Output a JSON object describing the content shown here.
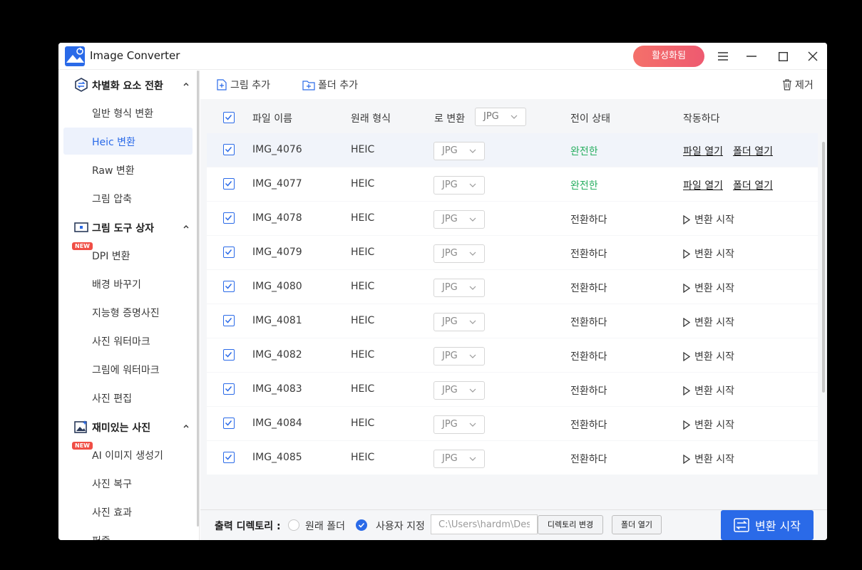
{
  "app": {
    "title": "Image Converter",
    "activate_label": "활성화됨"
  },
  "colors": {
    "accent": "#2a6ae8",
    "done": "#27ae60",
    "activate_start": "#f4706a",
    "activate_end": "#ee5a70",
    "badge": "#f04e45"
  },
  "sidebar": {
    "new_badge": "NEW",
    "groups": [
      {
        "label": "차별화 요소 전환",
        "icon": "convert-icon",
        "items": [
          {
            "label": "일반 형식 변환",
            "active": false,
            "new": false
          },
          {
            "label": "Heic 변환",
            "active": true,
            "new": false
          },
          {
            "label": "Raw 변환",
            "active": false,
            "new": false
          },
          {
            "label": "그림 압축",
            "active": false,
            "new": false
          }
        ]
      },
      {
        "label": "그림 도구 상자",
        "icon": "toolbox-icon",
        "items": [
          {
            "label": "DPI 변환",
            "active": false,
            "new": true
          },
          {
            "label": "배경 바꾸기",
            "active": false,
            "new": false
          },
          {
            "label": "지능형 증명사진",
            "active": false,
            "new": false
          },
          {
            "label": "사진 워터마크",
            "active": false,
            "new": false
          },
          {
            "label": "그림에 워터마크",
            "active": false,
            "new": false
          },
          {
            "label": "사진 편집",
            "active": false,
            "new": false
          }
        ]
      },
      {
        "label": "재미있는 사진",
        "icon": "fun-photo-icon",
        "items": [
          {
            "label": "AI 이미지 생성기",
            "active": false,
            "new": true
          },
          {
            "label": "사진 복구",
            "active": false,
            "new": false
          },
          {
            "label": "사진 효과",
            "active": false,
            "new": false
          },
          {
            "label": "퍼즐",
            "active": false,
            "new": false
          }
        ]
      }
    ]
  },
  "toolbar": {
    "add_image": "그림 추가",
    "add_folder": "폴더 추가",
    "remove": "제거"
  },
  "table": {
    "headers": {
      "name": "파일 이름",
      "orig": "원래 형식",
      "convert_to": "로 변환",
      "status": "전이 상태",
      "action": "작동하다"
    },
    "head_format": "JPG",
    "open_file": "파일 열기",
    "open_folder": "폴더 열기",
    "start_label": "변환 시작",
    "rows": [
      {
        "name": "IMG_4076",
        "orig": "HEIC",
        "format": "JPG",
        "status": "완전한",
        "done": true
      },
      {
        "name": "IMG_4077",
        "orig": "HEIC",
        "format": "JPG",
        "status": "완전한",
        "done": true
      },
      {
        "name": "IMG_4078",
        "orig": "HEIC",
        "format": "JPG",
        "status": "전환하다",
        "done": false
      },
      {
        "name": "IMG_4079",
        "orig": "HEIC",
        "format": "JPG",
        "status": "전환하다",
        "done": false
      },
      {
        "name": "IMG_4080",
        "orig": "HEIC",
        "format": "JPG",
        "status": "전환하다",
        "done": false
      },
      {
        "name": "IMG_4081",
        "orig": "HEIC",
        "format": "JPG",
        "status": "전환하다",
        "done": false
      },
      {
        "name": "IMG_4082",
        "orig": "HEIC",
        "format": "JPG",
        "status": "전환하다",
        "done": false
      },
      {
        "name": "IMG_4083",
        "orig": "HEIC",
        "format": "JPG",
        "status": "전환하다",
        "done": false
      },
      {
        "name": "IMG_4084",
        "orig": "HEIC",
        "format": "JPG",
        "status": "전환하다",
        "done": false
      },
      {
        "name": "IMG_4085",
        "orig": "HEIC",
        "format": "JPG",
        "status": "전환하다",
        "done": false
      }
    ]
  },
  "bottom": {
    "output_label": "출력 디렉토리 :",
    "option_original": "원래 폴더",
    "option_custom": "사용자 지정",
    "selected_option": "custom",
    "path_value": "C:\\Users\\hardm\\Des",
    "change_dir": "디렉토리 변경",
    "open_folder": "폴더 열기",
    "convert_label": "변환 시작"
  }
}
